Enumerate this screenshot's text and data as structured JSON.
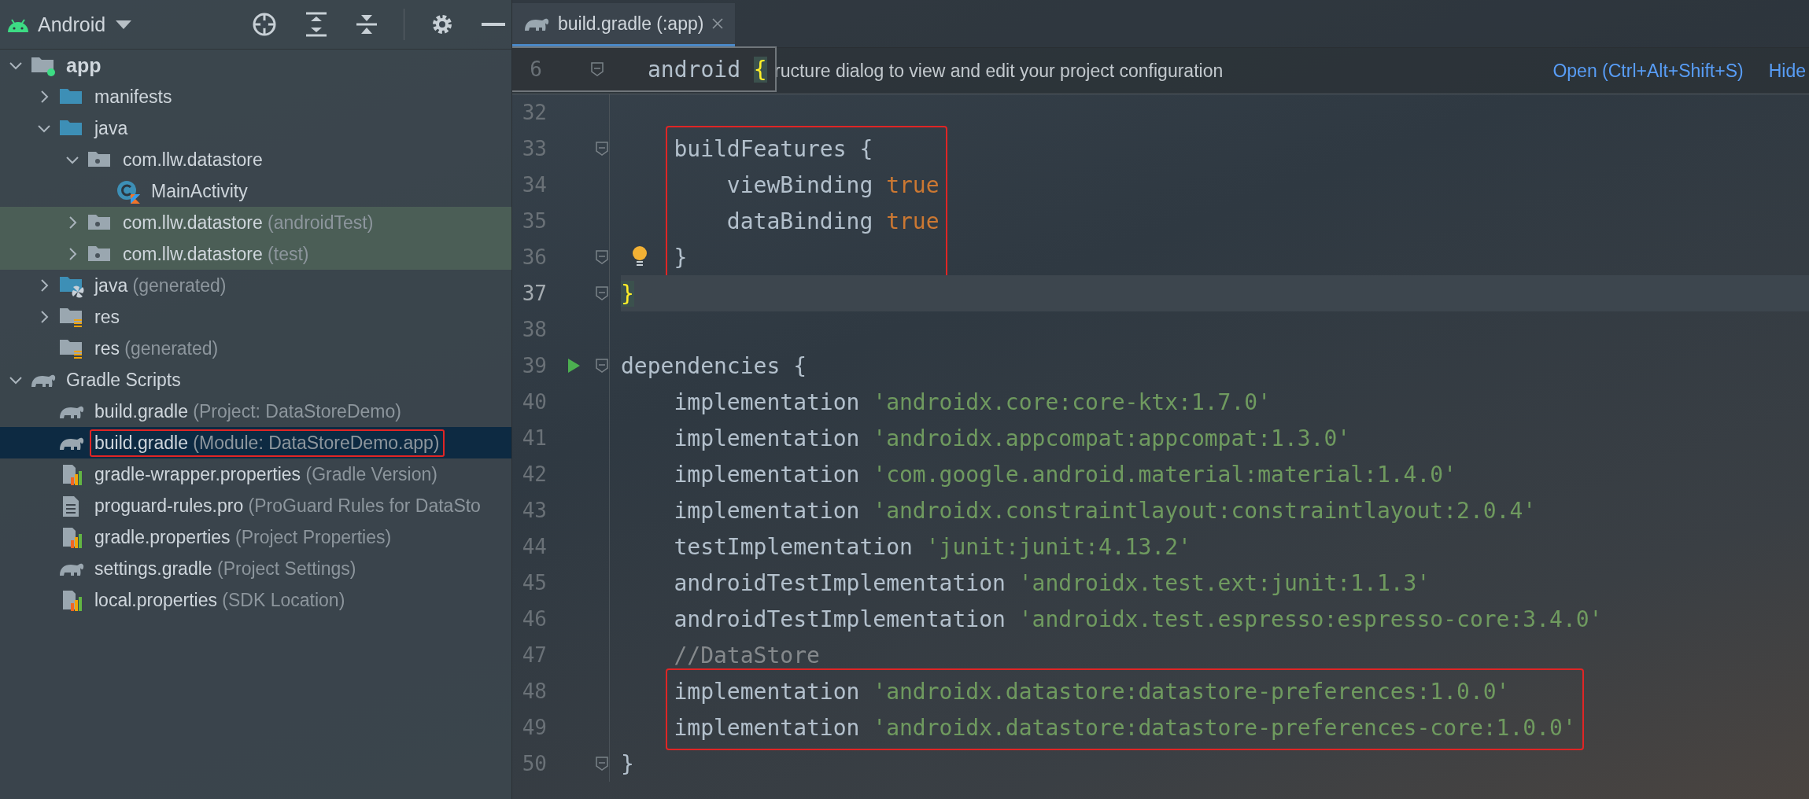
{
  "project_panel": {
    "view_title": "Android",
    "tree": [
      {
        "label": "app",
        "kind": "module",
        "expanded": true,
        "selected": false,
        "framed": false,
        "children": [
          {
            "label": "manifests",
            "kind": "folder",
            "expanded": false,
            "selected": false,
            "framed": false
          },
          {
            "label": "java",
            "kind": "folder",
            "expanded": true,
            "selected": false,
            "framed": false,
            "children": [
              {
                "label": "com.llw.datastore",
                "kind": "package",
                "expanded": true,
                "selected": false,
                "framed": false,
                "children": [
                  {
                    "label": "MainActivity",
                    "kind": "kotlin-class",
                    "selected": false,
                    "framed": false
                  }
                ]
              },
              {
                "label": "com.llw.datastore",
                "suffix": "(androidTest)",
                "kind": "test-package",
                "expanded": false,
                "selected": false,
                "framed": false
              },
              {
                "label": "com.llw.datastore",
                "suffix": "(test)",
                "kind": "test-package",
                "expanded": false,
                "selected": false,
                "framed": false
              }
            ]
          },
          {
            "label": "java",
            "suffix": "(generated)",
            "kind": "generated-folder",
            "expanded": false,
            "selected": false,
            "framed": false
          },
          {
            "label": "res",
            "kind": "res-folder",
            "expanded": false,
            "selected": false,
            "framed": false
          },
          {
            "label": "res",
            "suffix": "(generated)",
            "kind": "res-folder",
            "selected": false,
            "framed": false
          }
        ]
      },
      {
        "label": "Gradle Scripts",
        "kind": "gradle-group",
        "expanded": true,
        "selected": false,
        "framed": false,
        "children": [
          {
            "label": "build.gradle",
            "suffix": "(Project: DataStoreDemo)",
            "kind": "gradle",
            "selected": false,
            "framed": false
          },
          {
            "label": "build.gradle",
            "suffix": "(Module: DataStoreDemo.app)",
            "kind": "gradle",
            "selected": true,
            "framed": true
          },
          {
            "label": "gradle-wrapper.properties",
            "suffix": "(Gradle Version)",
            "kind": "properties",
            "selected": false,
            "framed": false
          },
          {
            "label": "proguard-rules.pro",
            "suffix": "(ProGuard Rules for DataSto",
            "kind": "proguard",
            "selected": false,
            "framed": false
          },
          {
            "label": "gradle.properties",
            "suffix": "(Project Properties)",
            "kind": "properties",
            "selected": false,
            "framed": false
          },
          {
            "label": "settings.gradle",
            "suffix": "(Project Settings)",
            "kind": "gradle",
            "selected": false,
            "framed": false
          },
          {
            "label": "local.properties",
            "suffix": "(SDK Location)",
            "kind": "properties",
            "selected": false,
            "framed": false
          }
        ]
      }
    ]
  },
  "editor": {
    "tabs": [
      {
        "label": "build.gradle (:app)",
        "selected": true
      }
    ],
    "sticky_line": {
      "number": "6",
      "fold": true,
      "run": false,
      "bulb": false,
      "segments": [
        {
          "kind": "plain",
          "text": "android "
        },
        {
          "kind": "brace-match",
          "text": "{"
        }
      ]
    },
    "banner": {
      "text": "ructure dialog to view and edit your project configuration",
      "links": [
        "Open (Ctrl+Alt+Shift+S)",
        "Hide"
      ]
    },
    "lines": [
      {
        "number": "32",
        "current": false,
        "framed": false,
        "fold": false,
        "run": false,
        "bulb": false
      },
      {
        "number": "33",
        "current": false,
        "framed": true,
        "fold": true,
        "run": false,
        "bulb": false,
        "segments": [
          {
            "kind": "plain",
            "text": "    buildFeatures {"
          }
        ]
      },
      {
        "number": "34",
        "current": false,
        "framed": true,
        "fold": false,
        "run": false,
        "bulb": false,
        "segments": [
          {
            "kind": "plain",
            "text": "        viewBinding "
          },
          {
            "kind": "keyword",
            "text": "true"
          }
        ]
      },
      {
        "number": "35",
        "current": false,
        "framed": true,
        "fold": false,
        "run": false,
        "bulb": false,
        "segments": [
          {
            "kind": "plain",
            "text": "        dataBinding "
          },
          {
            "kind": "keyword",
            "text": "true"
          }
        ]
      },
      {
        "number": "36",
        "current": false,
        "framed": true,
        "fold": true,
        "run": false,
        "bulb": true,
        "segments": [
          {
            "kind": "plain",
            "text": "    }"
          }
        ]
      },
      {
        "number": "37",
        "current": true,
        "framed": false,
        "fold": true,
        "run": false,
        "bulb": false,
        "segments": [
          {
            "kind": "brace-match",
            "text": "}"
          }
        ]
      },
      {
        "number": "38",
        "current": false,
        "framed": false,
        "fold": false,
        "run": false,
        "bulb": false
      },
      {
        "number": "39",
        "current": false,
        "framed": false,
        "fold": true,
        "run": true,
        "bulb": false,
        "segments": [
          {
            "kind": "plain",
            "text": "dependencies {"
          }
        ]
      },
      {
        "number": "40",
        "current": false,
        "framed": false,
        "fold": false,
        "run": false,
        "bulb": false,
        "segments": [
          {
            "kind": "plain",
            "text": "    implementation "
          },
          {
            "kind": "string",
            "text": "'androidx.core:core-ktx:1.7.0'"
          }
        ]
      },
      {
        "number": "41",
        "current": false,
        "framed": false,
        "fold": false,
        "run": false,
        "bulb": false,
        "segments": [
          {
            "kind": "plain",
            "text": "    implementation "
          },
          {
            "kind": "string",
            "text": "'androidx.appcompat:appcompat:1.3.0'"
          }
        ]
      },
      {
        "number": "42",
        "current": false,
        "framed": false,
        "fold": false,
        "run": false,
        "bulb": false,
        "segments": [
          {
            "kind": "plain",
            "text": "    implementation "
          },
          {
            "kind": "string",
            "text": "'com.google.android.material:material:1.4.0'"
          }
        ]
      },
      {
        "number": "43",
        "current": false,
        "framed": false,
        "fold": false,
        "run": false,
        "bulb": false,
        "segments": [
          {
            "kind": "plain",
            "text": "    implementation "
          },
          {
            "kind": "string",
            "text": "'androidx.constraintlayout:constraintlayout:2.0.4'"
          }
        ]
      },
      {
        "number": "44",
        "current": false,
        "framed": false,
        "fold": false,
        "run": false,
        "bulb": false,
        "segments": [
          {
            "kind": "plain",
            "text": "    testImplementation "
          },
          {
            "kind": "string",
            "text": "'junit:junit:4.13.2'"
          }
        ]
      },
      {
        "number": "45",
        "current": false,
        "framed": false,
        "fold": false,
        "run": false,
        "bulb": false,
        "segments": [
          {
            "kind": "plain",
            "text": "    androidTestImplementation "
          },
          {
            "kind": "string",
            "text": "'androidx.test.ext:junit:1.1.3'"
          }
        ]
      },
      {
        "number": "46",
        "current": false,
        "framed": false,
        "fold": false,
        "run": false,
        "bulb": false,
        "segments": [
          {
            "kind": "plain",
            "text": "    androidTestImplementation "
          },
          {
            "kind": "string",
            "text": "'androidx.test.espresso:espresso-core:3.4.0'"
          }
        ]
      },
      {
        "number": "47",
        "current": false,
        "framed": false,
        "fold": false,
        "run": false,
        "bulb": false,
        "segments": [
          {
            "kind": "comment",
            "text": "    //DataStore"
          }
        ]
      },
      {
        "number": "48",
        "current": false,
        "framed": true,
        "fold": false,
        "run": false,
        "bulb": false,
        "segments": [
          {
            "kind": "plain",
            "text": "    implementation "
          },
          {
            "kind": "string",
            "text": "'androidx.datastore:datastore-preferences:1.0.0'"
          }
        ]
      },
      {
        "number": "49",
        "current": false,
        "framed": true,
        "fold": false,
        "run": false,
        "bulb": false,
        "segments": [
          {
            "kind": "plain",
            "text": "    implementation "
          },
          {
            "kind": "string",
            "text": "'androidx.datastore:datastore-preferences-core:1.0.0'"
          }
        ]
      },
      {
        "number": "50",
        "current": false,
        "framed": false,
        "fold": true,
        "run": false,
        "bulb": false,
        "segments": [
          {
            "kind": "plain",
            "text": "}"
          }
        ]
      }
    ]
  }
}
